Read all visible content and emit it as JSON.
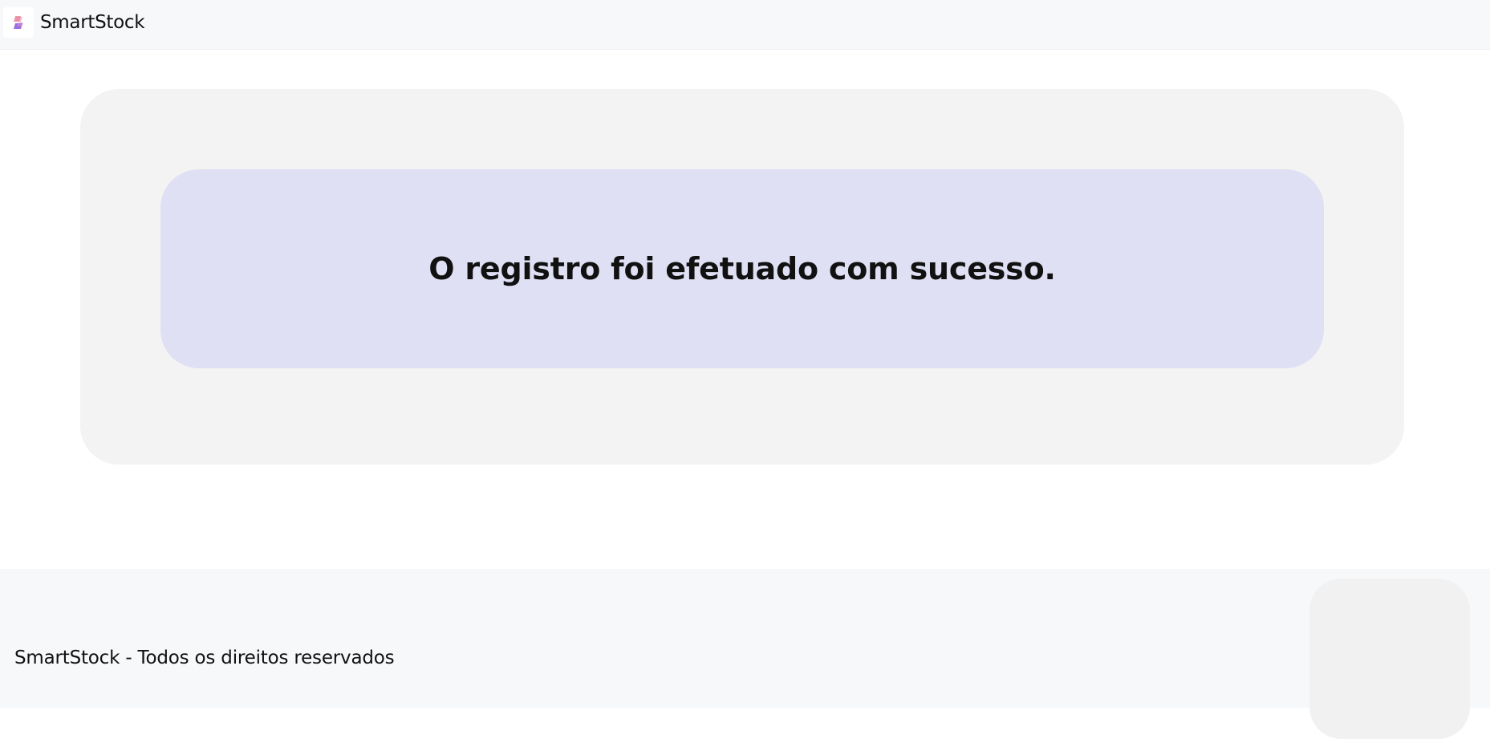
{
  "navbar": {
    "brand_name": "SmartStock",
    "logo_icon": "smartstock-logo-icon",
    "colors": {
      "background": "#f7f8fa",
      "logo_pink": "#e58aa6",
      "logo_purple": "#9b6de0"
    }
  },
  "main": {
    "message": "O registro foi efetuado com sucesso.",
    "colors": {
      "outer_card": "#f3f3f3",
      "inner_card": "#e0e0f4"
    }
  },
  "footer": {
    "text": "SmartStock - Todos os direitos reservados",
    "colors": {
      "background": "#f7f8fa"
    }
  }
}
